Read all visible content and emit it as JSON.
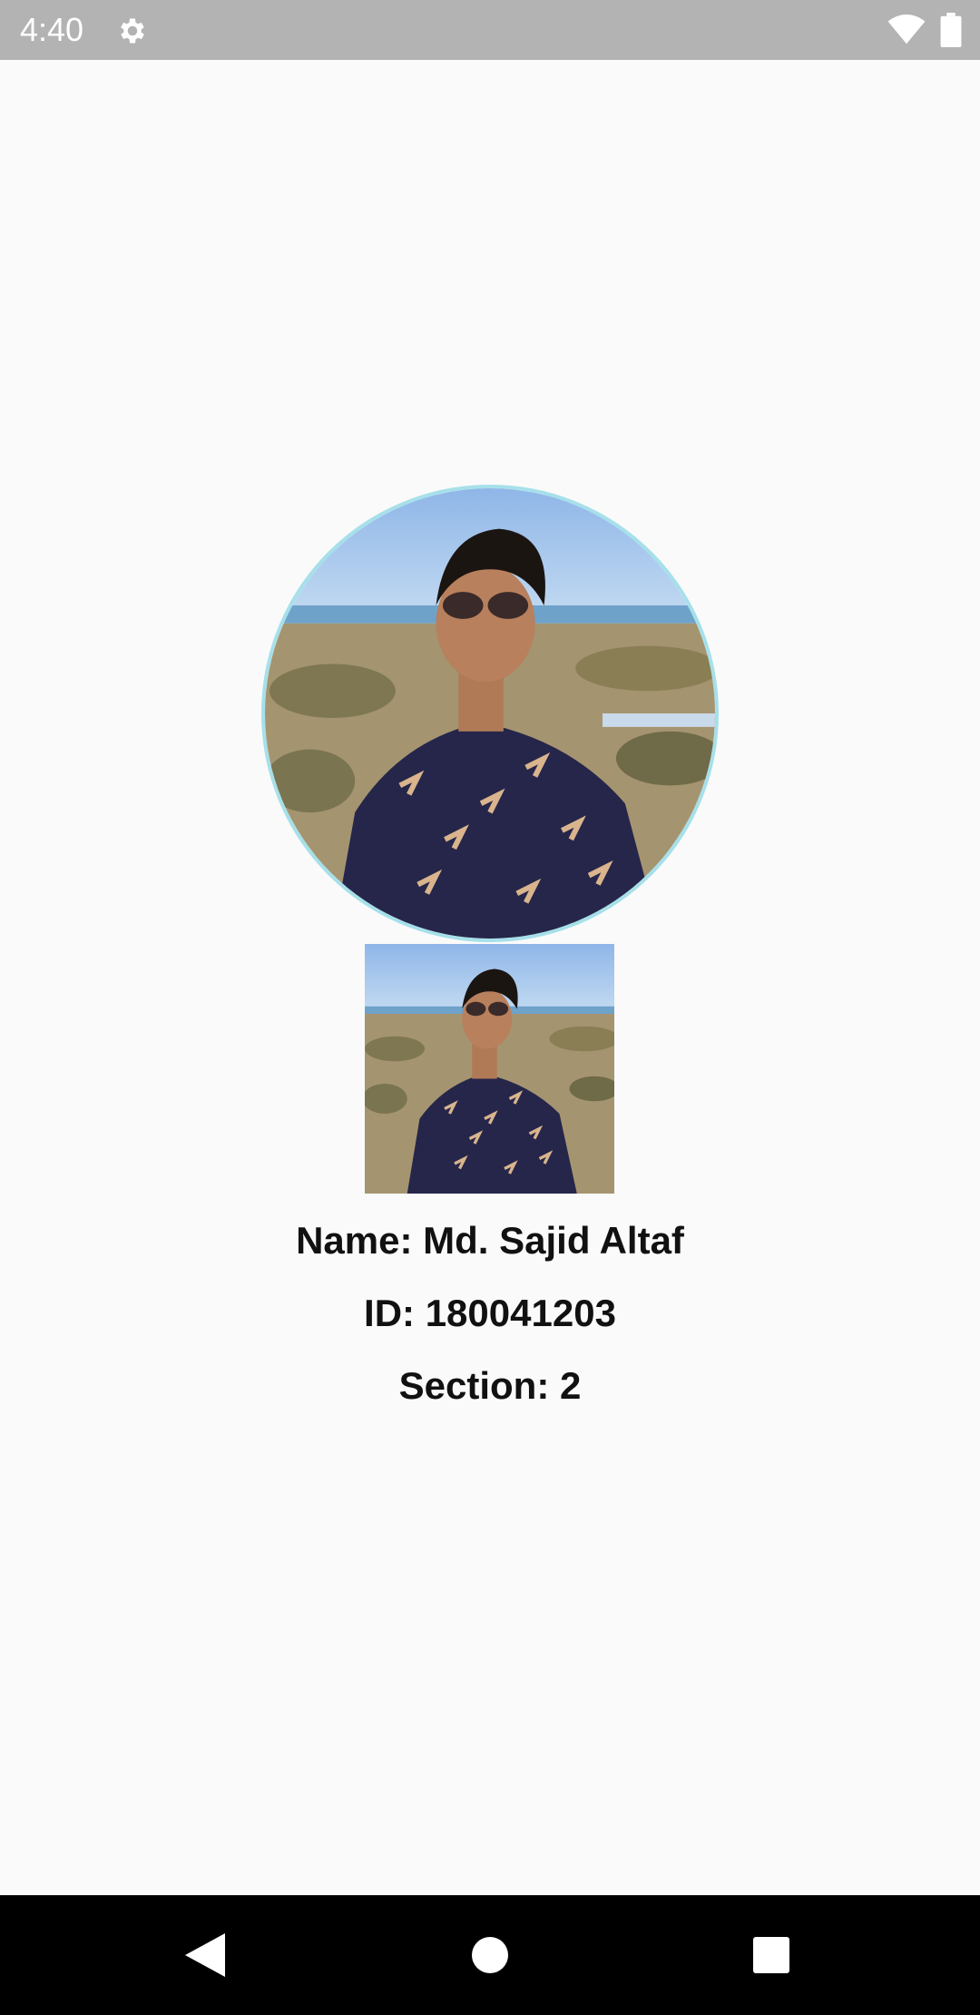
{
  "status_bar": {
    "time": "4:40",
    "icons": [
      "gear-icon",
      "wifi-icon",
      "battery-icon"
    ],
    "background": "#b3b3b3"
  },
  "profile": {
    "photo_description_icon": "profile-photo",
    "avatar_border_color": "#a6e0ea",
    "name_line": "Name: Md. Sajid Altaf",
    "id_line": "ID: 180041203",
    "section_line": "Section: 2"
  },
  "nav_bar": {
    "icons": [
      "back-icon",
      "home-icon",
      "recents-icon"
    ],
    "background": "#000000"
  }
}
